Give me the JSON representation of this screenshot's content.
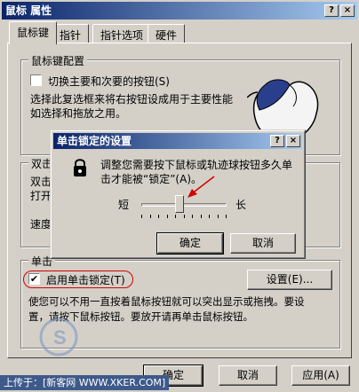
{
  "window": {
    "title": "鼠标 属性",
    "help_btn": "?",
    "close_btn": "×"
  },
  "tabs": [
    {
      "label": "鼠标键"
    },
    {
      "label": "指针"
    },
    {
      "label": "指针选项"
    },
    {
      "label": "硬件"
    }
  ],
  "button_config": {
    "title": "鼠标键配置",
    "switch_label": "切换主要和次要的按钮(S)",
    "switch_checked": false,
    "description": [
      "选择此复选框来将右按钮设成用于主要性能",
      "如选择和拖放之用。"
    ]
  },
  "double_click": {
    "title": "双击",
    "desc_partial": [
      "双击",
      "打开"
    ],
    "speed_label": "速度"
  },
  "click_lock": {
    "title": "单击",
    "enable_label": "启用单击锁定(T)",
    "enable_checked": true,
    "settings_button": "设置(E)...",
    "description": [
      "使您可以不用一直按着鼠标按钮就可以突出显示或拖拽。要设",
      "置，请按下鼠标按钮。要放开请再单击鼠标按钮。"
    ]
  },
  "dialog": {
    "title": "单击锁定的设置",
    "help_btn": "?",
    "close_btn": "×",
    "message": [
      "调整您需要按下鼠标或轨迹球按钮多久单",
      "击才能被“锁定”(A)。"
    ],
    "slider_min_label": "短",
    "slider_max_label": "长",
    "slider_value": 0.45,
    "ok_button": "确定",
    "cancel_button": "取消"
  },
  "footer": {
    "ok_button": "确定",
    "cancel_button": "取消",
    "apply_button": "应用(A)"
  },
  "watermark": {
    "text": "上传于：[新客网 WWW.XKER.COM]"
  },
  "colors": {
    "title_start": "#0a246a",
    "title_end": "#a6caf0",
    "face": "#d4d0c8",
    "annotation": "#d40000"
  }
}
